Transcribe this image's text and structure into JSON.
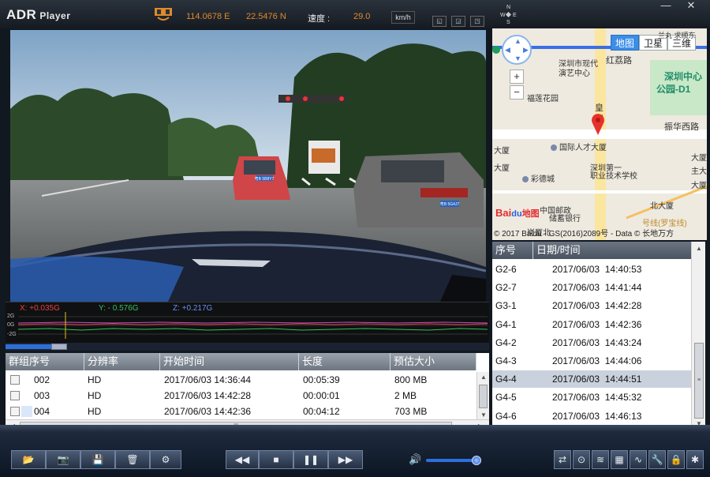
{
  "app": {
    "name_main": "ADR",
    "name_sub": "Player"
  },
  "gps": {
    "longitude": "114.0678 E",
    "latitude": "22.5476 N",
    "speed_label": "速度 :",
    "speed_value": "29.0",
    "speed_unit": "km/h"
  },
  "compass": {
    "n": "N",
    "w": "W",
    "e": "E",
    "s": "S"
  },
  "window_controls": {
    "minimize": "—",
    "close": "✕"
  },
  "gsensor": {
    "x": "X: +0.035G",
    "y": "Y: - 0.576G",
    "z": "Z: +0.217G",
    "ticks": [
      "2G",
      "0G",
      "-2G"
    ]
  },
  "video": {
    "plate_front": "粤B 5B8Y7",
    "plate_right": "粤B 5G4J7"
  },
  "groups_table": {
    "headers": [
      "群组序号",
      "分辨率",
      "开始时间",
      "长度",
      "预估大小"
    ],
    "rows": [
      {
        "id": "002",
        "res": "HD",
        "start": "2017/06/03 14:36:44",
        "length": "00:05:39",
        "size": "800 MB"
      },
      {
        "id": "003",
        "res": "HD",
        "start": "2017/06/03 14:42:28",
        "length": "00:00:01",
        "size": "2 MB"
      },
      {
        "id": "004",
        "res": "HD",
        "start": "2017/06/03 14:42:36",
        "length": "00:04:12",
        "size": "703 MB"
      }
    ],
    "hscroll_grip": "III"
  },
  "map": {
    "tabs": [
      "地图",
      "卫星",
      "三维"
    ],
    "labels": {
      "l1": "深圳市现代",
      "l2": "演艺中心",
      "l3": "福莲花园",
      "l4": "红荔路",
      "l5": "皇",
      "l6": "岗",
      "l7": "深圳中心",
      "l8": "公园-D1",
      "l9": "振华西路",
      "l10": "国际人才大厦",
      "l11": "深圳第一",
      "l12": "职业技术学校",
      "l13": "彩德城",
      "l14": "中国邮政",
      "l15": "储蓄银行",
      "l16": "大厦",
      "l17": "大厦",
      "l18": "主大厦",
      "l19": "大厦",
      "l20": "大厦",
      "l21": "北大厦",
      "l22": "岗厦北",
      "l23": "号线(罗宝线)",
      "l24": "兰丸 求顺东",
      "brand_bai": "Bai",
      "brand_du": "du",
      "brand_map": "地图"
    },
    "zoom_in": "+",
    "zoom_out": "−",
    "copyright": "© 2017 Baidu - GS(2016)2089号 - Data © 长地万方"
  },
  "files_table": {
    "headers": [
      "序号",
      "日期/时间"
    ],
    "rows": [
      {
        "id": "G2-6",
        "dt": "2017/06/03  14:40:53"
      },
      {
        "id": "G2-7",
        "dt": "2017/06/03  14:41:44"
      },
      {
        "id": "G3-1",
        "dt": "2017/06/03  14:42:28"
      },
      {
        "id": "G4-1",
        "dt": "2017/06/03  14:42:36"
      },
      {
        "id": "G4-2",
        "dt": "2017/06/03  14:43:24"
      },
      {
        "id": "G4-3",
        "dt": "2017/06/03  14:44:06"
      },
      {
        "id": "G4-4",
        "dt": "2017/06/03  14:44:51"
      },
      {
        "id": "G4-5",
        "dt": "2017/06/03  14:45:32"
      },
      {
        "id": "G4-6",
        "dt": "2017/06/03  14:46:13"
      }
    ],
    "selected_index": 6
  },
  "toolbar": {
    "open": "📂",
    "snapshot": "📷",
    "save": "💾",
    "delete": "🗑",
    "settings": "⚙",
    "rewind": "◀◀",
    "stop": "■",
    "pause": "❚❚",
    "forward": "▶▶",
    "volume": "🔊",
    "t1": "⇄",
    "t2": "⊙",
    "t3": "≋",
    "t4": "▦",
    "t5": "∿",
    "t6": "🔧",
    "t7": "🔒",
    "t8": "✱"
  },
  "volume_level": 0.92
}
